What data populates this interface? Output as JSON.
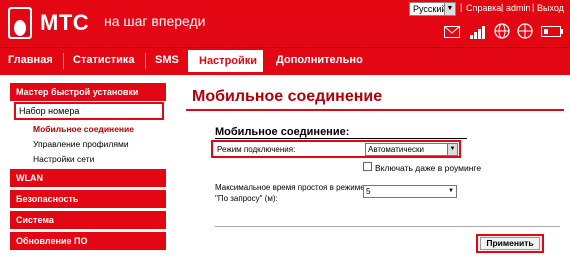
{
  "header": {
    "brand": "МТС",
    "slogan": "на шаг впереди",
    "language": "Русский",
    "links": [
      "Справка",
      "admin",
      "Выход"
    ],
    "separator": "|"
  },
  "status_icons": [
    "envelope-icon",
    "signal-bars-icon",
    "globe-icon",
    "connection-status-icon"
  ],
  "nav": {
    "tabs": [
      "Главная",
      "Статистика",
      "SMS",
      "Настройки",
      "Дополнительно"
    ],
    "active": "Настройки"
  },
  "sidebar": {
    "quick_setup": "Мастер быстрой установки",
    "dial_up": "Набор номера",
    "sub_items": [
      "Мобильное соединение",
      "Управление профилями",
      "Настройки сети"
    ],
    "sections": [
      "WLAN",
      "Безопасность",
      "Система",
      "Обновление ПО"
    ]
  },
  "main": {
    "title": "Мобильное соединение",
    "subtitle": "Мобильное соединение:",
    "mode_label": "Режим подключения:",
    "mode_value": "Автоматически",
    "roaming_label": "Включать даже в роуминге",
    "idle_label": "Максимальное время простоя в режиме \"По запросу\" (м):",
    "idle_value": "5",
    "apply": "Применить"
  },
  "colors": {
    "brand_red": "#e30613",
    "dark_red": "#b0000c"
  }
}
